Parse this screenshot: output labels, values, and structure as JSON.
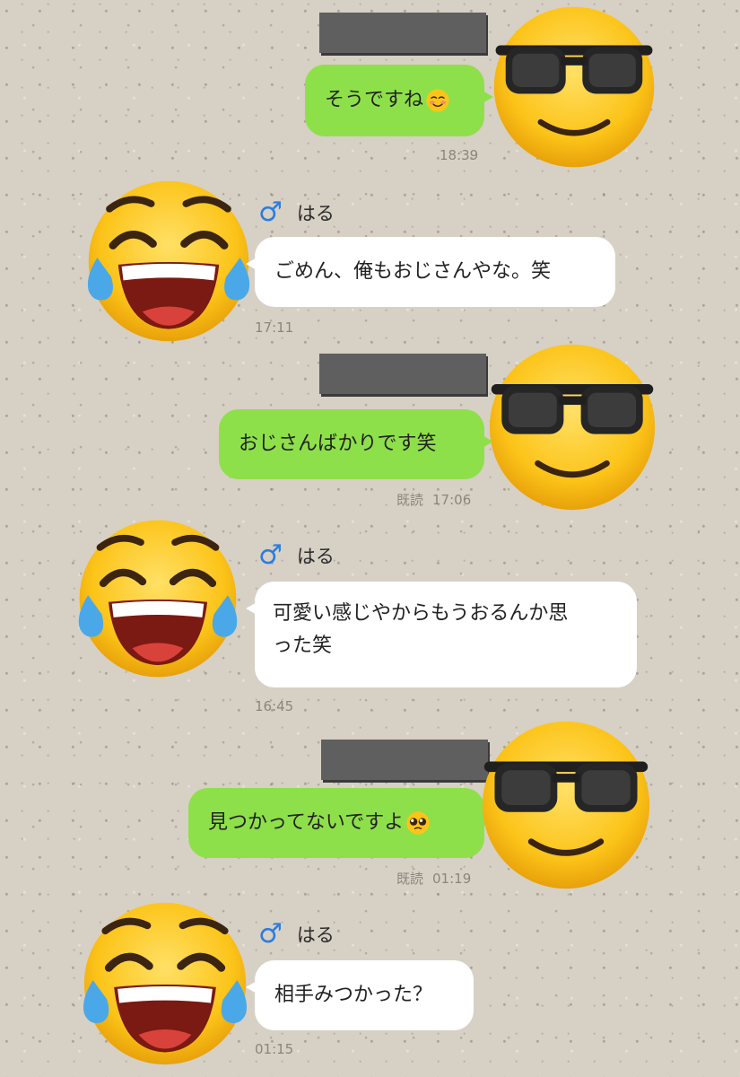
{
  "messages": [
    {
      "direction": "out",
      "text": "そうですね",
      "emoji": "smiling-face-emoji",
      "read": "",
      "time": "18:39"
    },
    {
      "direction": "in",
      "sender": "はる",
      "sender_icon": "male-sign-icon",
      "text": "ごめん、俺もおじさんやな。笑",
      "time": "17:11"
    },
    {
      "direction": "out",
      "text": "おじさんばかりです笑",
      "read": "既読",
      "time": "17:06"
    },
    {
      "direction": "in",
      "sender": "はる",
      "sender_icon": "male-sign-icon",
      "text_line1": "可愛い感じやからもうおるんか思",
      "text_line2": "った笑",
      "time": "16:45"
    },
    {
      "direction": "out",
      "text": "見つかってないですよ",
      "emoji": "pleading-face-emoji",
      "read": "既読",
      "time": "01:19"
    },
    {
      "direction": "in",
      "sender": "はる",
      "sender_icon": "male-sign-icon",
      "text": "相手みつかった？",
      "time": "01:15"
    }
  ],
  "avatars": {
    "self": "sunglasses-face-emoji",
    "other": "tears-of-joy-emoji"
  },
  "colors": {
    "outgoing_bubble": "#8ee04a",
    "incoming_bubble": "#ffffff",
    "background": "#d7d0c5",
    "male_sign": "#2a7de1",
    "redaction": "#5f5f5f"
  }
}
